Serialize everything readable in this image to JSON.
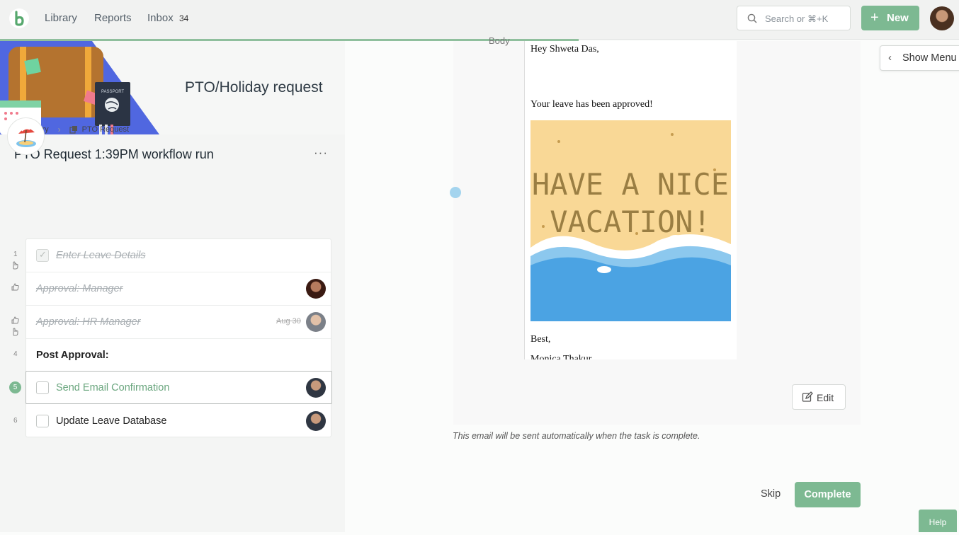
{
  "nav": {
    "links": [
      {
        "label": "Library"
      },
      {
        "label": "Reports"
      },
      {
        "label": "Inbox"
      }
    ],
    "inbox_count": "34",
    "search_placeholder": "Search or ⌘+K",
    "new_label": "New"
  },
  "banner": {
    "title": "PTO/Holiday request"
  },
  "breadcrumb": {
    "library": "Library",
    "current": "PTO Request"
  },
  "run": {
    "title": "PTO Request 1:39PM workflow run",
    "more": "···"
  },
  "tasks": [
    {
      "num": "1",
      "label": "Enter Leave Details"
    },
    {
      "num": "",
      "label": "Approval: Manager"
    },
    {
      "num": "",
      "label": "Approval: HR Manager",
      "date": "Aug 30"
    },
    {
      "num": "4",
      "label": "Post Approval:"
    },
    {
      "num": "5",
      "label": "Send Email Confirmation"
    },
    {
      "num": "6",
      "label": "Update Leave Database"
    }
  ],
  "email": {
    "body_label": "Body",
    "greeting": "Hey Shweta Das,",
    "message": "Your leave has been approved!",
    "image_text_line1": "HAVE A NICE",
    "image_text_line2": "VACATION!",
    "signoff": "Best,",
    "signature": "Monica Thakur"
  },
  "actions": {
    "edit": "Edit",
    "note": "This email will be sent automatically when the task is complete.",
    "skip": "Skip",
    "complete": "Complete",
    "show_menu": "Show Menu",
    "help": "Help"
  },
  "colors": {
    "accent_green": "#7db992",
    "strike_grey": "#a9afb3",
    "sea_blue": "#4ba3e3",
    "sand": "#f9d896"
  }
}
